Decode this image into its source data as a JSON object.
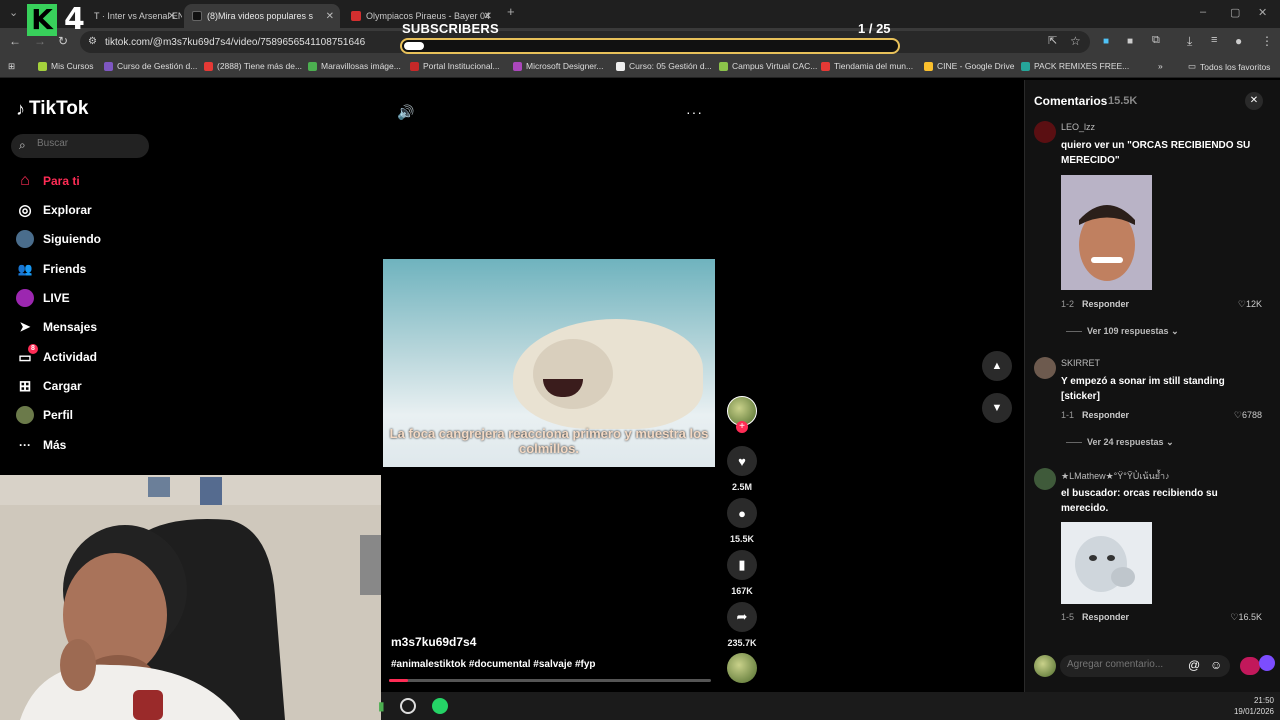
{
  "browser": {
    "tabs": [
      {
        "label": "T · Inter vs Arsenal EN",
        "favicon_color": "#2e7d32"
      },
      {
        "label": "(8)Mira videos populares s",
        "favicon_color": "#000000"
      },
      {
        "label": "Olympiacos Piraeus - Bayer 04",
        "favicon_color": "#d32f2f"
      }
    ],
    "url": "tiktok.com/@m3s7ku69d7s4/video/7589656541108751646",
    "bookmarks": [
      {
        "label": "Mis Cursos",
        "color": "#a4d13c"
      },
      {
        "label": "Curso de Gestión d...",
        "color": "#7e57c2"
      },
      {
        "label": "(2888) Tiene más de...",
        "color": "#e53935"
      },
      {
        "label": "Maravillosas imáge...",
        "color": "#4caf50"
      },
      {
        "label": "Portal Institucional...",
        "color": "#c62828"
      },
      {
        "label": "Microsoft Designer...",
        "color": "#ab47bc"
      },
      {
        "label": "Curso: 05 Gestión d...",
        "color": "#eeeeee"
      },
      {
        "label": "Campus Virtual CAC...",
        "color": "#8bc34a"
      },
      {
        "label": "Tiendamia del mun...",
        "color": "#e53935"
      },
      {
        "label": "CINE - Google Drive",
        "color": "#fbc02d"
      },
      {
        "label": "PACK REMIXES FREE...",
        "color": "#26a69a"
      }
    ],
    "all_favorites": "Todos los favoritos"
  },
  "overlay": {
    "subs_label": "SUBSCRIBERS",
    "subs_count": "1  / 25",
    "subs_progress": 0.04,
    "logo_letter": "K",
    "logo_number": "4"
  },
  "tiktok": {
    "brand": "TikTok",
    "search_placeholder": "Buscar",
    "nav": [
      {
        "label": "Para ti",
        "icon": "home-icon",
        "glyph": "⌂"
      },
      {
        "label": "Explorar",
        "icon": "compass-icon",
        "glyph": "◎"
      },
      {
        "label": "Siguiendo",
        "icon": "following-avatar-icon",
        "glyph": "●"
      },
      {
        "label": "Friends",
        "icon": "friends-icon",
        "glyph": "👥"
      },
      {
        "label": "LIVE",
        "icon": "live-icon",
        "glyph": "●"
      },
      {
        "label": "Mensajes",
        "icon": "send-icon",
        "glyph": "➤"
      },
      {
        "label": "Actividad",
        "icon": "activity-icon",
        "glyph": "▭"
      },
      {
        "label": "Cargar",
        "icon": "upload-icon",
        "glyph": "⊞"
      },
      {
        "label": "Perfil",
        "icon": "profile-avatar-icon",
        "glyph": "●"
      },
      {
        "label": "Más",
        "icon": "more-dots-icon",
        "glyph": "···"
      }
    ],
    "activity_badge": "8",
    "video": {
      "caption": "La foca cangrejera reacciona primero y muestra los colmillos.",
      "author": "m3s7ku69d7s4",
      "hashtags": "#animalestiktok #documental #salvaje #fyp",
      "progress": 0.06
    },
    "actions": {
      "likes": "2.5M",
      "comments": "15.5K",
      "saves": "167K",
      "shares": "235.7K"
    }
  },
  "comments": {
    "title": "Comentarios",
    "count": "15.5K",
    "items": [
      {
        "user": "LEO_lzz",
        "text": "quiero ver un \"ORCAS RECIBIENDO SU MERECIDO\"",
        "date": "1-2",
        "reply": "Responder",
        "likes": "12K",
        "replies": "Ver 109 respuestas"
      },
      {
        "user": "SKIRRET",
        "text": "Y empezó a sonar im still standing [sticker]",
        "date": "1-1",
        "reply": "Responder",
        "likes": "6788",
        "replies": "Ver 24 respuestas"
      },
      {
        "user": "★LMathew★°Ÿ°ỸỦเน้นย้ำ♪",
        "text": "el buscador: orcas recibiendo su merecido.",
        "date": "1-5",
        "reply": "Responder",
        "likes": "16.5K"
      }
    ],
    "input_placeholder": "Agregar comentario..."
  },
  "taskbar": {
    "time": "21:50",
    "date": "19/01/2026"
  }
}
